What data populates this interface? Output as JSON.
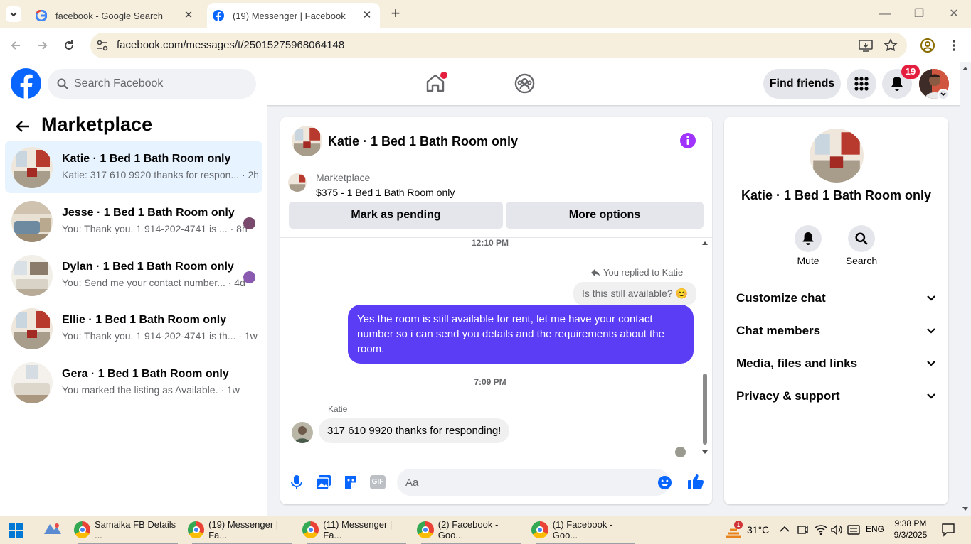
{
  "browser": {
    "tabs": [
      {
        "title": "facebook - Google Search"
      },
      {
        "title": "(19) Messenger | Facebook"
      }
    ],
    "url": "facebook.com/messages/t/25015275968064148"
  },
  "fb_header": {
    "search_placeholder": "Search Facebook",
    "find_friends": "Find friends",
    "notification_count": "19"
  },
  "left_panel": {
    "title": "Marketplace",
    "conversations": [
      {
        "name": "Katie · 1 Bed 1 Bath Room only",
        "preview": "Katie: 317 610 9920 thanks for respon...",
        "time": "· 2h"
      },
      {
        "name": "Jesse · 1 Bed 1 Bath Room only",
        "preview": "You: Thank you. 1 914-202-4741 is ...",
        "time": "· 8h"
      },
      {
        "name": "Dylan · 1 Bed 1 Bath Room only",
        "preview": "You: Send me your contact number...",
        "time": "· 4d"
      },
      {
        "name": "Ellie · 1 Bed 1 Bath Room only",
        "preview": "You: Thank you. 1 914-202-4741 is th...",
        "time": "· 1w"
      },
      {
        "name": "Gera · 1 Bed 1 Bath Room only",
        "preview": "You marked the listing as Available.",
        "time": "· 1w"
      }
    ]
  },
  "chat": {
    "title": "Katie · 1 Bed 1 Bath Room only",
    "listing_source": "Marketplace",
    "listing_title": "$375 - 1 Bed 1 Bath Room only",
    "mark_pending": "Mark as pending",
    "more_options": "More options",
    "time1": "12:10 PM",
    "replied_to": "You replied to Katie",
    "quoted": "Is this still available? 😊",
    "outgoing": "Yes the room is still available for rent, let me have your contact number so i can send you details and the requirements about the room.",
    "time2": "7:09 PM",
    "sender": "Katie",
    "incoming": "317 610 9920 thanks for responding!",
    "composer_placeholder": "Aa"
  },
  "right_panel": {
    "name": "Katie · 1 Bed 1 Bath Room only",
    "mute": "Mute",
    "search": "Search",
    "sections": [
      "Customize chat",
      "Chat members",
      "Media, files and links",
      "Privacy & support"
    ]
  },
  "taskbar": {
    "items": [
      "Samaika FB Details ...",
      "(19) Messenger | Fa...",
      "(11) Messenger | Fa...",
      "(2) Facebook - Goo...",
      "(1) Facebook - Goo..."
    ],
    "temperature": "31°C",
    "language": "ENG",
    "time": "9:38 PM",
    "date": "9/3/2025",
    "weather_badge": "1"
  },
  "colors": {
    "fb_blue": "#0866ff",
    "bubble_purple": "#5b3df5",
    "accent_purple": "#a033ff"
  }
}
